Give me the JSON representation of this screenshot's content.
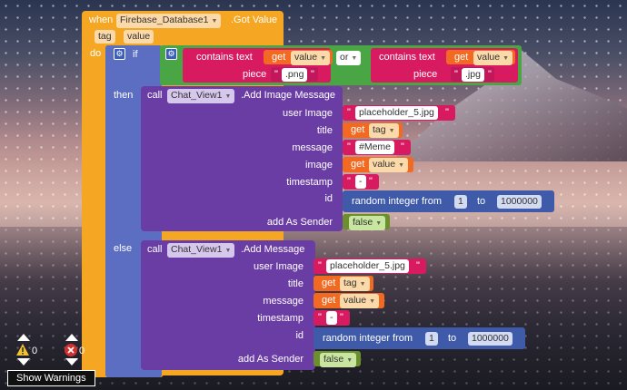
{
  "event": {
    "when_label": "when",
    "component": "Firebase_Database1",
    "event_name": ".Got Value",
    "params": [
      "tag",
      "value"
    ],
    "do_label": "do"
  },
  "if_block": {
    "if_label": "if",
    "or_label": "or",
    "conditions": [
      {
        "label": "contains text",
        "get_label": "get",
        "var": "value",
        "piece_label": "piece",
        "piece_value": ".png"
      },
      {
        "label": "contains text",
        "get_label": "get",
        "var": "value",
        "piece_label": "piece",
        "piece_value": ".jpg"
      }
    ],
    "then_label": "then",
    "else_label": "else"
  },
  "then_call": {
    "call_label": "call",
    "component": "Chat_View1",
    "method": ".Add Image Message",
    "params": {
      "user_image_label": "user Image",
      "user_image_value": "placeholder_5.jpg",
      "title_label": "title",
      "title_get": "get",
      "title_var": "tag",
      "message_label": "message",
      "message_value": "#Meme",
      "image_label": "image",
      "image_get": "get",
      "image_var": "value",
      "timestamp_label": "timestamp",
      "timestamp_value": "-",
      "id_label": "id",
      "random_label": "random integer from",
      "random_from": "1",
      "random_to_label": "to",
      "random_to": "1000000",
      "add_as_sender_label": "add As Sender",
      "add_as_sender_value": "false"
    }
  },
  "else_call": {
    "call_label": "call",
    "component": "Chat_View1",
    "method": ".Add Message",
    "params": {
      "user_image_label": "user Image",
      "user_image_value": "placeholder_5.jpg",
      "title_label": "title",
      "title_get": "get",
      "title_var": "tag",
      "message_label": "message",
      "message_get": "get",
      "message_var": "value",
      "timestamp_label": "timestamp",
      "timestamp_value": "-",
      "id_label": "id",
      "random_label": "random integer from",
      "random_from": "1",
      "random_to_label": "to",
      "random_to": "1000000",
      "add_as_sender_label": "add As Sender",
      "add_as_sender_value": "false"
    }
  },
  "status": {
    "warning_count": "0",
    "error_count": "0",
    "show_warnings_label": "Show Warnings"
  },
  "colors": {
    "event": "#f5a623",
    "control": "#5b6ec2",
    "text_logic": "#4aa544",
    "text": "#d81b60",
    "component_method": "#6a3da4",
    "variable_get": "#f26a21",
    "math": "#3f5aa8"
  }
}
